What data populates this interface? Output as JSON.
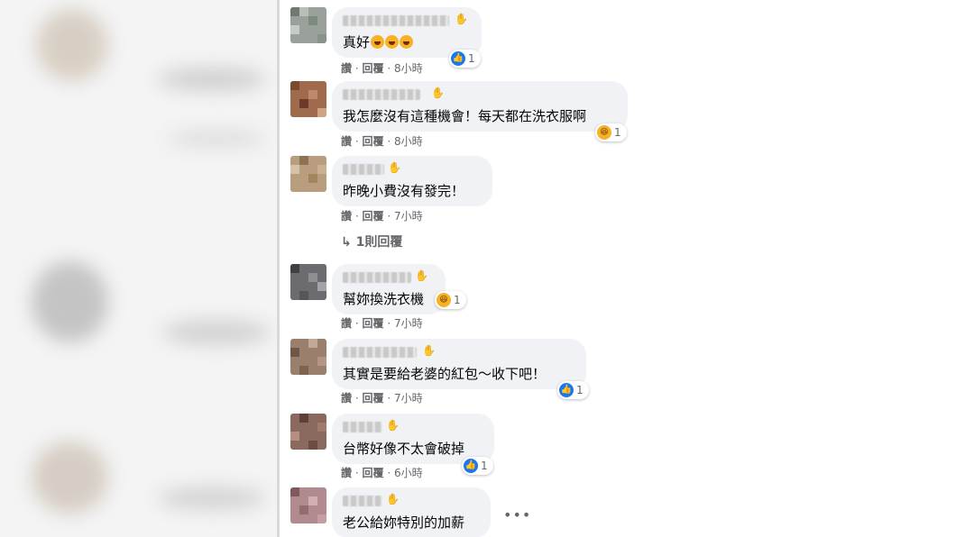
{
  "actions": {
    "like": "讚",
    "reply": "回覆",
    "sep": "·"
  },
  "comments": [
    {
      "text": "真好",
      "time": "8小時",
      "reaction_count": "1",
      "reaction_type": "like"
    },
    {
      "text": "我怎麼沒有這種機會！每天都在洗衣服啊",
      "time": "8小時",
      "reaction_count": "1",
      "reaction_type": "haha"
    },
    {
      "text": "昨晚小費沒有發完！",
      "time": "7小時"
    },
    {
      "text": "幫妳換洗衣機",
      "time": "7小時",
      "reaction_count": "1",
      "reaction_type": "haha"
    },
    {
      "text": "其實是要給老婆的紅包～收下吧！",
      "time": "7小時",
      "reaction_count": "1",
      "reaction_type": "like"
    },
    {
      "text": "台幣好像不太會破掉",
      "time": "6小時",
      "reaction_count": "1",
      "reaction_type": "like"
    },
    {
      "text": "老公給妳特別的加薪"
    }
  ],
  "reply_link": "1則回覆",
  "icons": {
    "reply_arrow": "reply-arrow-icon",
    "wave": "wave-icon",
    "more": "more-icon"
  },
  "colors": {
    "bubble": "#f0f2f5",
    "like": "#1877f2",
    "haha": "#f7b125",
    "meta": "#65676b"
  }
}
